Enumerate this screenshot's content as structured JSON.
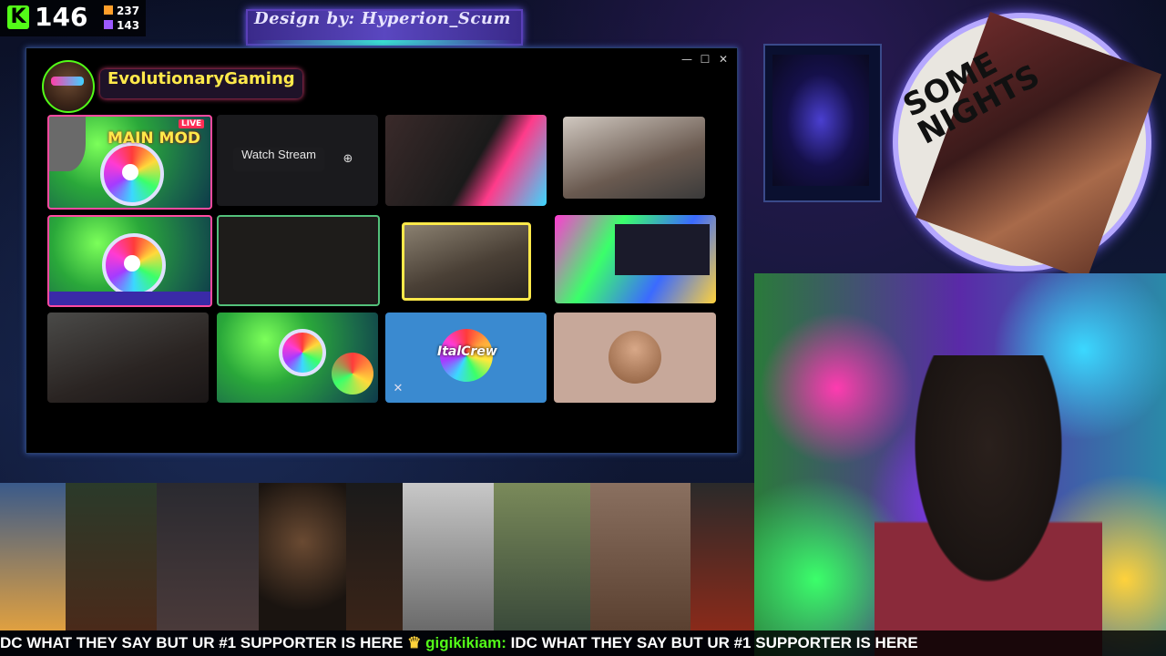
{
  "kick": {
    "count": "146",
    "stat_top": "237",
    "stat_bottom": "143",
    "accent": "#53fc18"
  },
  "banner": {
    "text": "Design by: Hyperion_Scum"
  },
  "discord": {
    "channel_name": "EvolutionaryGaming",
    "controls": [
      "—",
      "☐",
      "✕"
    ],
    "tiles": {
      "main_mod_label": "MAIN MOD",
      "live_badge": "LIVE",
      "watch_stream": "Watch Stream",
      "party_label": "ItalCrew"
    }
  },
  "album": {
    "title_line1": "SOME",
    "title_line2": "NIGHTS"
  },
  "ticker": {
    "lead": "DC WHAT THEY SAY BUT UR #1 SUPPORTER IS HERE",
    "user": "gigikikiam:",
    "message": "IDC WHAT THEY SAY BUT UR #1 SUPPORTER IS HERE"
  }
}
